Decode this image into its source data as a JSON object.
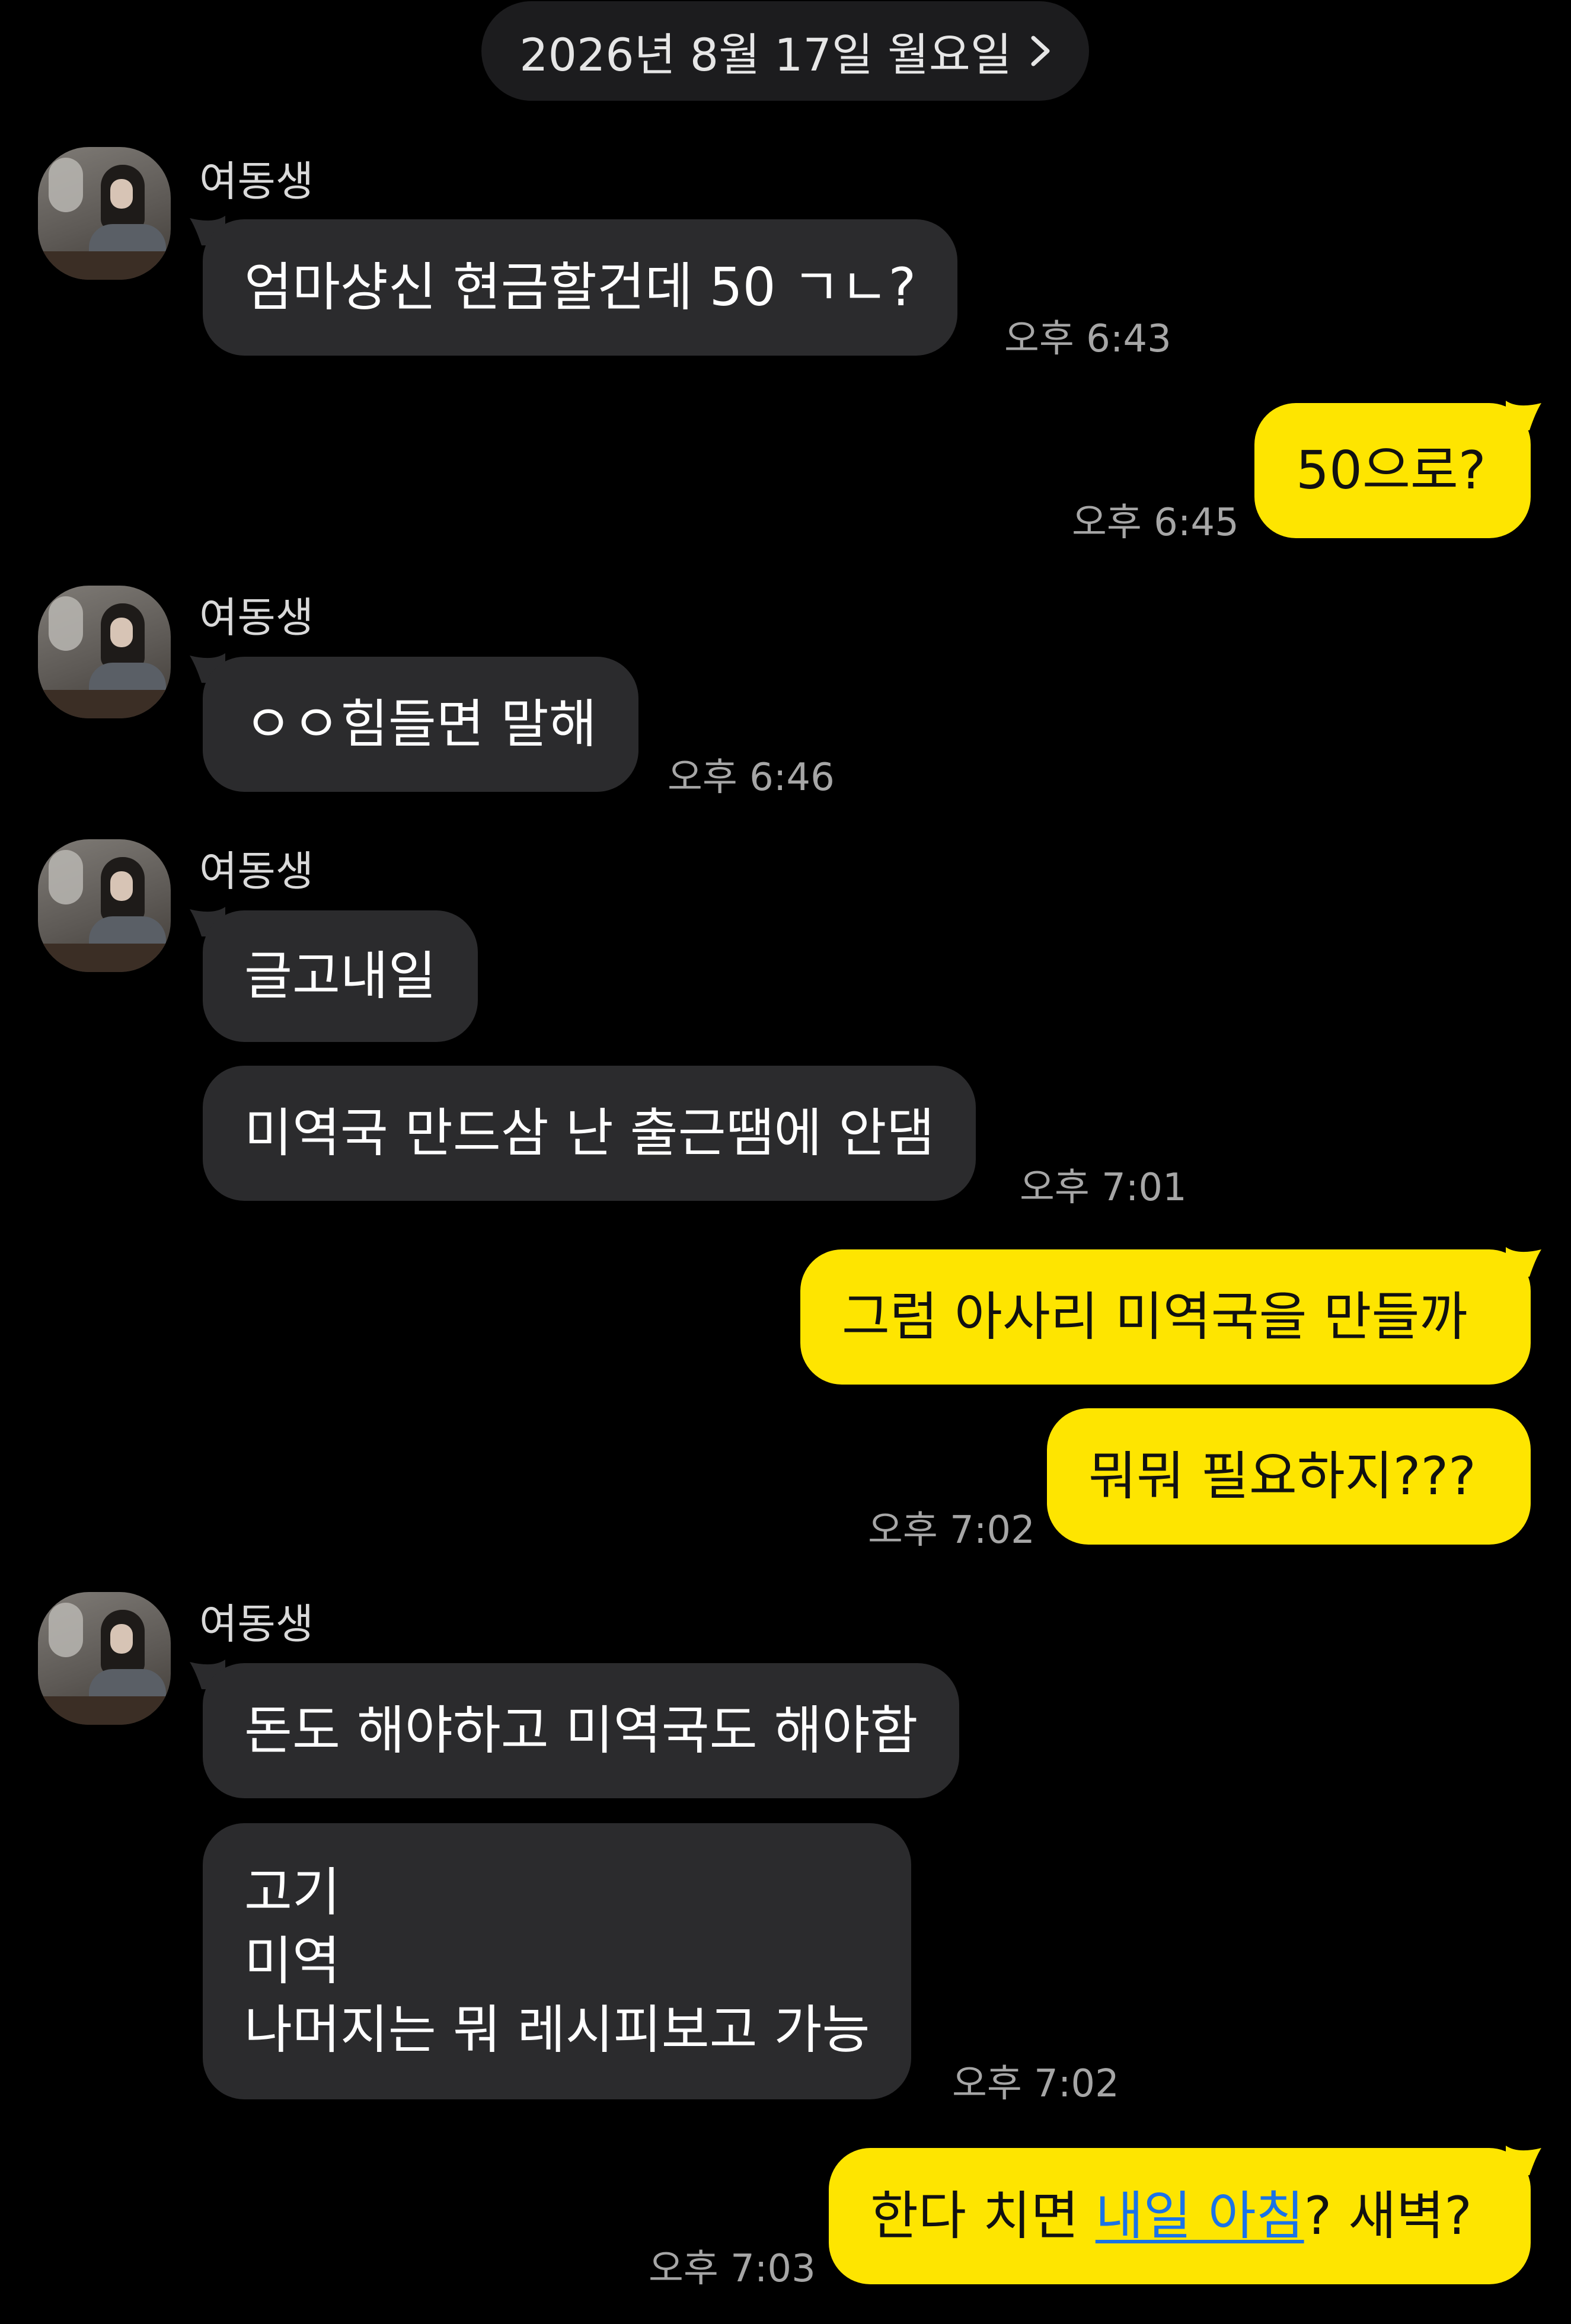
{
  "date_header": "2026년 8월 17일 월요일",
  "sender_name": "여동생",
  "messages": [
    {
      "text": "엄마샹신 현금할건데 50 ㄱㄴ?",
      "time": "오후 6:43"
    },
    {
      "text": "50으로?",
      "time": "오후 6:45"
    },
    {
      "text": "ㅇㅇ힘들면 말해",
      "time": "오후 6:46"
    },
    {
      "text": "글고내일"
    },
    {
      "text": "미역국 만드삼 난 출근땜에 안댐",
      "time": "오후 7:01"
    },
    {
      "text": "그럼 아사리 미역국을 만들까"
    },
    {
      "text": "뭐뭐 필요하지???",
      "time": "오후 7:02"
    },
    {
      "text": "돈도 해야하고 미역국도 해야함"
    },
    {
      "lines": [
        "고기",
        "미역",
        "나머지는 뭐 레시피보고 가능"
      ],
      "time": "오후 7:02"
    },
    {
      "text_before": "한다 치면 ",
      "link": "내일 아침",
      "text_after": "? 새벽?",
      "time": "오후 7:03"
    }
  ],
  "colors": {
    "background": "#000000",
    "incoming_bubble": "#2b2b2d",
    "outgoing_bubble": "#fee500",
    "link": "#1a73e8",
    "timestamp": "#a6a6a6"
  },
  "icons": {
    "date_header": "chevron-right-icon",
    "avatar": "profile-photo"
  }
}
